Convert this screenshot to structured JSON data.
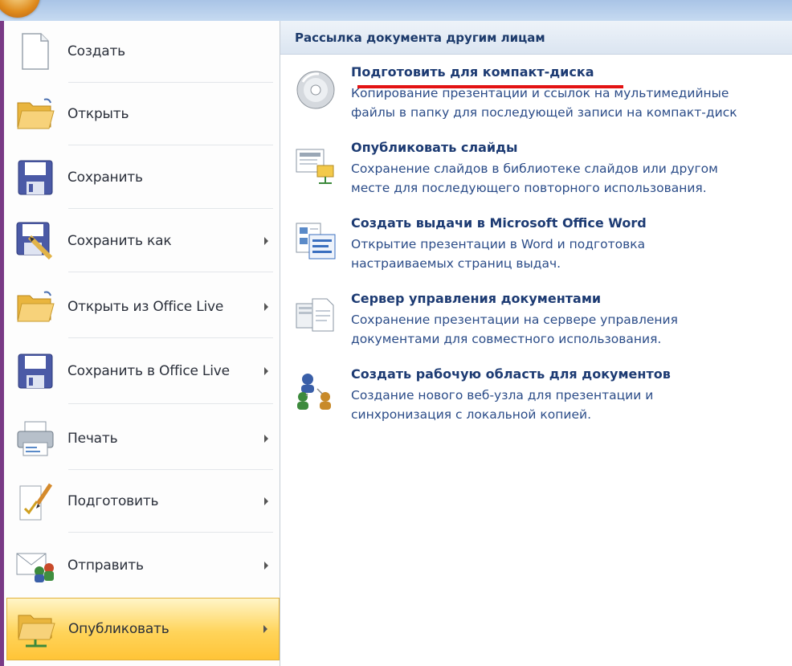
{
  "menu": {
    "items": [
      {
        "label": "Создать",
        "icon": "new-document-icon"
      },
      {
        "label": "Открыть",
        "icon": "open-folder-icon"
      },
      {
        "label": "Сохранить",
        "icon": "save-floppy-icon"
      },
      {
        "label": "Сохранить как",
        "icon": "save-as-icon"
      },
      {
        "label": "Открыть из Office Live",
        "icon": "open-folder-icon"
      },
      {
        "label": "Сохранить в Office Live",
        "icon": "save-floppy-icon"
      },
      {
        "label": "Печать",
        "icon": "printer-icon"
      },
      {
        "label": "Подготовить",
        "icon": "prepare-document-icon"
      },
      {
        "label": "Отправить",
        "icon": "send-icon"
      },
      {
        "label": "Опубликовать",
        "icon": "publish-folder-icon"
      }
    ],
    "selected": "Опубликовать"
  },
  "panel": {
    "header": "Рассылка документа другим лицам",
    "entries": [
      {
        "title": "Подготовить для компакт-диска",
        "desc1": "Копирование презентации и ссылок на мультимедийные",
        "desc2": "файлы в папку для последующей записи на компакт-диск",
        "icon": "cd-disc-icon"
      },
      {
        "title": "Опубликовать слайды",
        "desc1": "Сохранение слайдов в библиотеке слайдов или другом",
        "desc2": "месте для последующего повторного использования.",
        "icon": "publish-slides-icon"
      },
      {
        "title": "Создать выдачи в Microsoft Office Word",
        "desc1": "Открытие презентации в Word и подготовка",
        "desc2": "настраиваемых страниц выдач.",
        "icon": "word-handouts-icon"
      },
      {
        "title": "Сервер управления документами",
        "desc1": "Сохранение презентации на сервере управления",
        "desc2": "документами для совместного использования.",
        "icon": "document-server-icon"
      },
      {
        "title": "Создать рабочую область для документов",
        "desc1": "Создание нового веб-узла для презентации и",
        "desc2": "синхронизация с локальной копией.",
        "icon": "workspace-users-icon"
      }
    ]
  },
  "colors": {
    "background": "#7a3a86",
    "selected_item": "#ffd45a",
    "header_text": "#1c3a6b",
    "link_text": "#1d3b73",
    "annotation_red": "#e31313"
  }
}
